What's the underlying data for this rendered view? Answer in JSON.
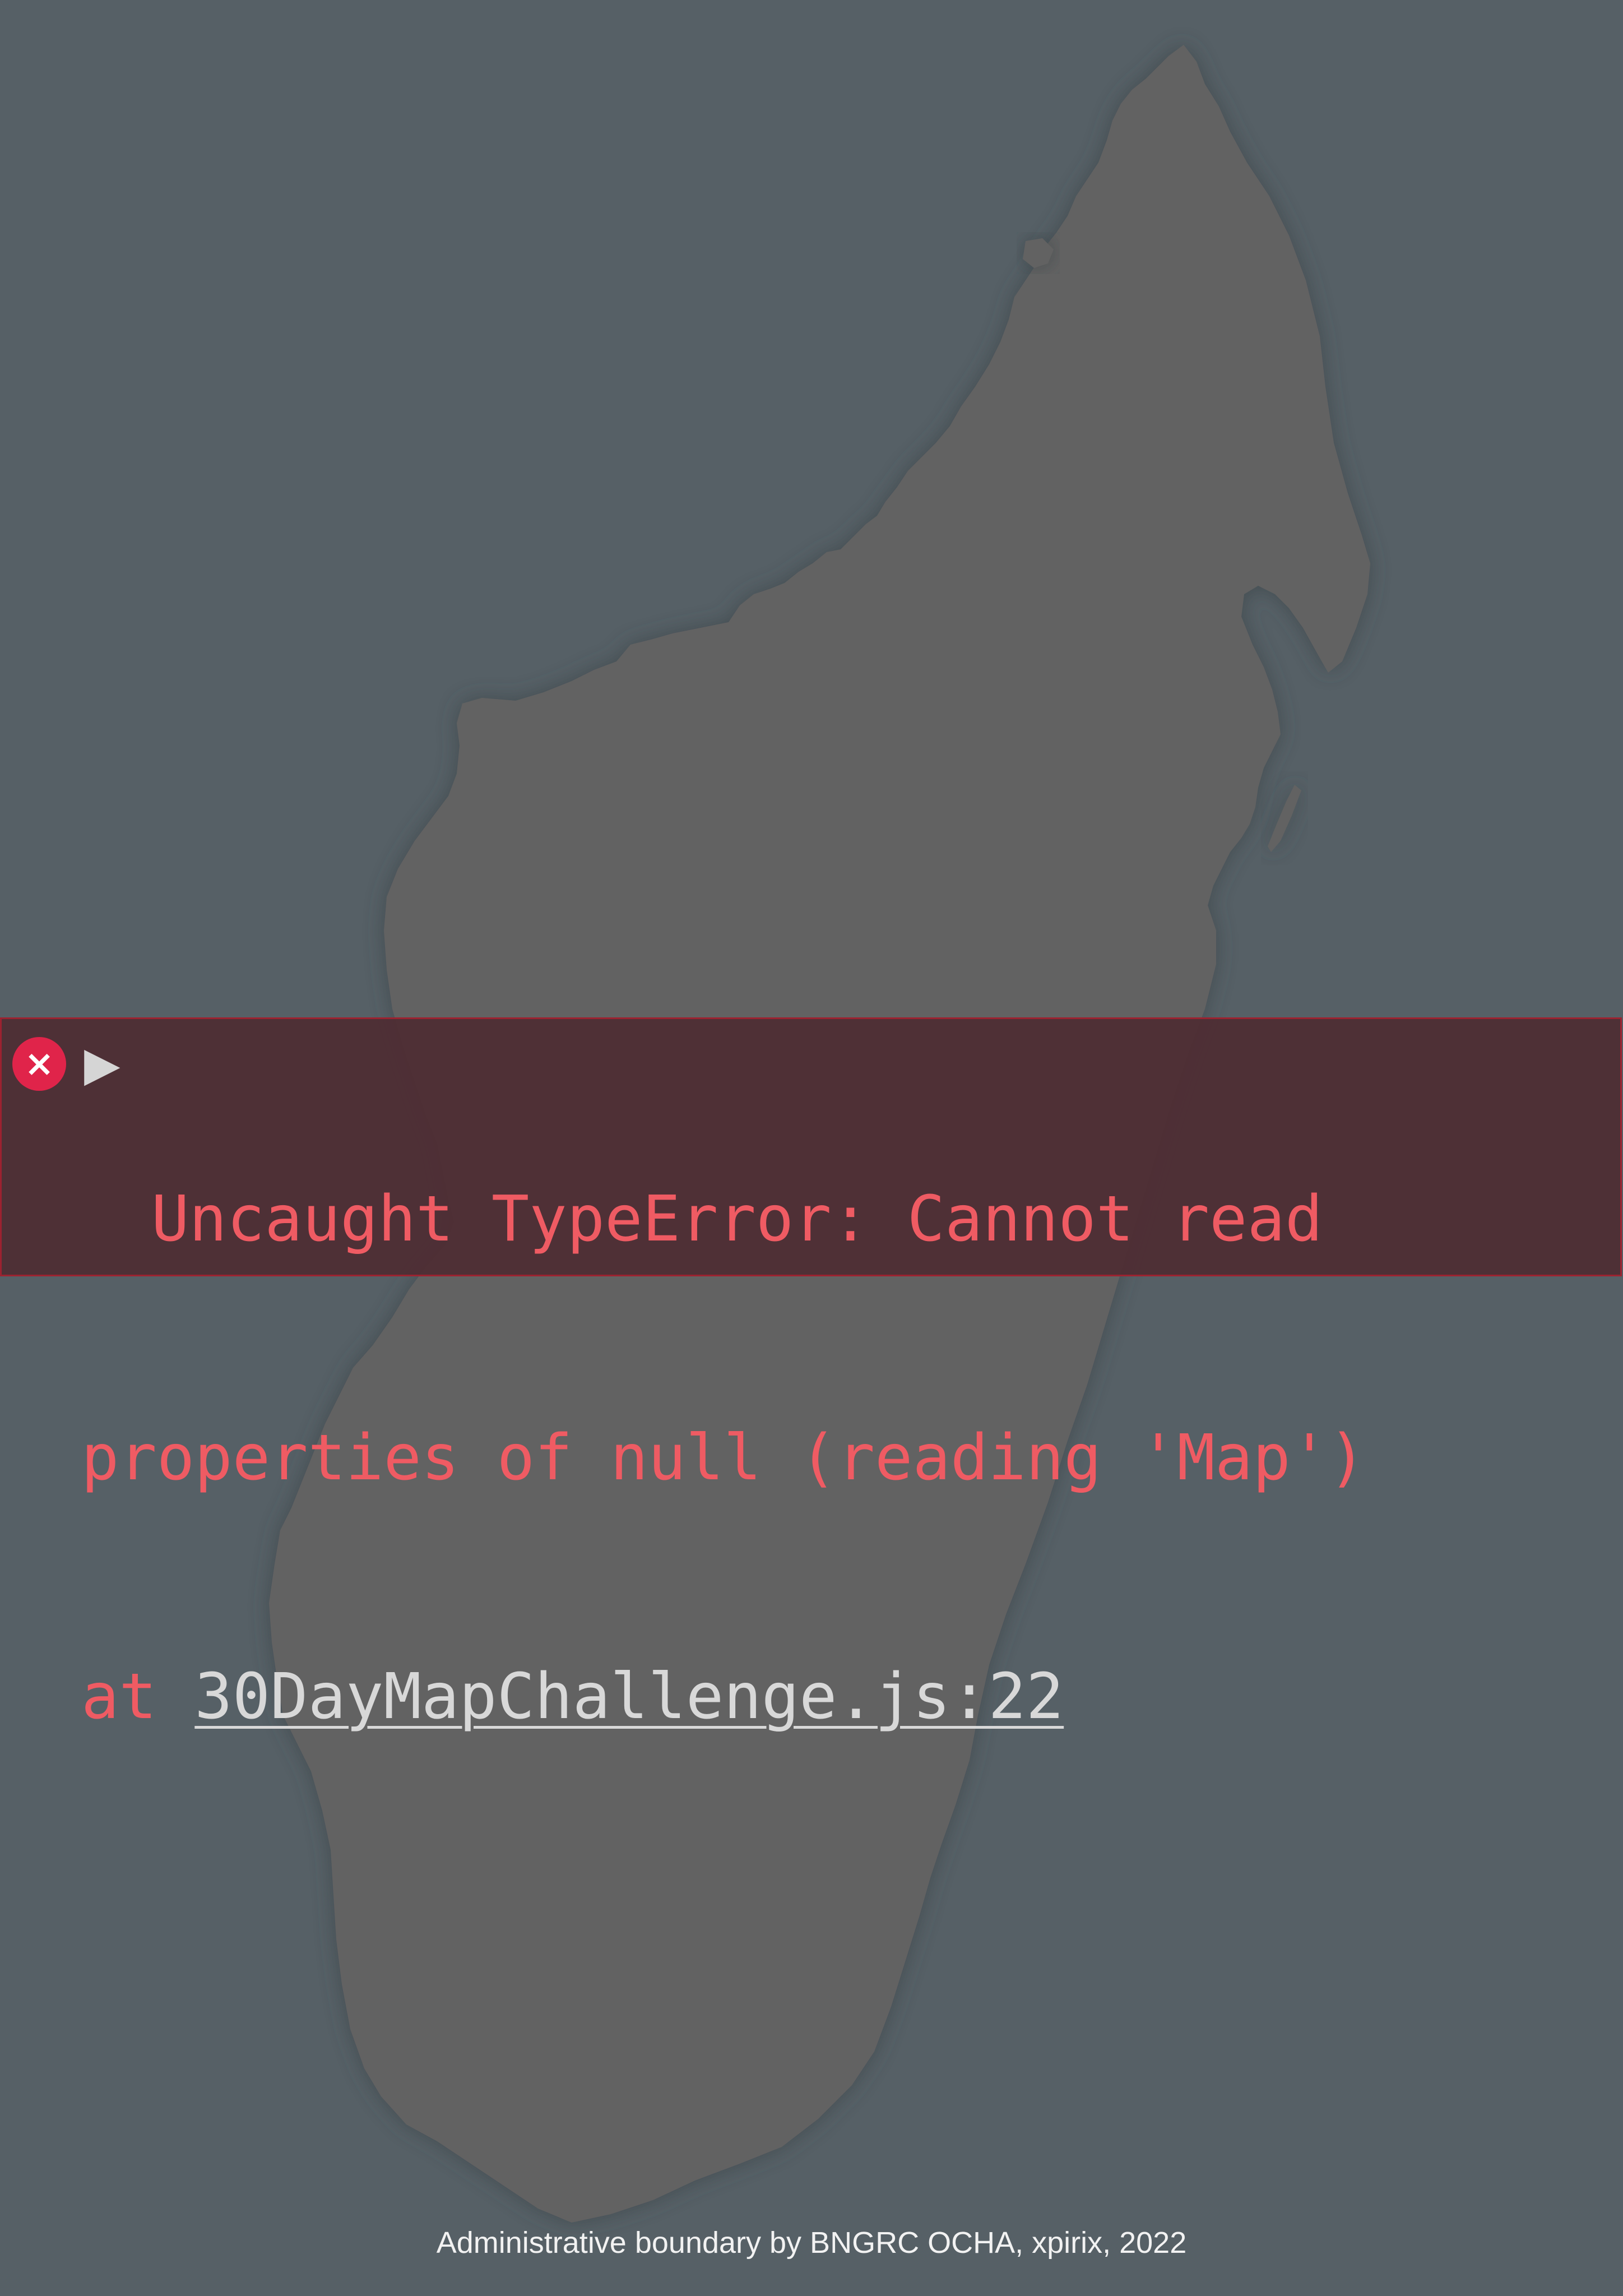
{
  "colors": {
    "sea": "#566066",
    "land": "#626262",
    "error_background": "#4e2e34",
    "error_border": "#9c2230",
    "error_icon": "#e0244a",
    "error_text": "#ef5b63",
    "link_text": "#d8d8d8",
    "credits_text": "#f2f2f2"
  },
  "map": {
    "feature": "Madagascar"
  },
  "console_error": {
    "icon": "error-x-icon",
    "icon_glyph": "×",
    "expand_icon": "triangle-right-icon",
    "expand_glyph": "▶",
    "line1": "Uncaught TypeError: Cannot read",
    "line2": "properties of null (reading 'Map')",
    "line3_prefix": "at ",
    "source_link": "30DayMapChallenge.js:22"
  },
  "credits": "Administrative boundary by BNGRC OCHA, xpirix, 2022"
}
